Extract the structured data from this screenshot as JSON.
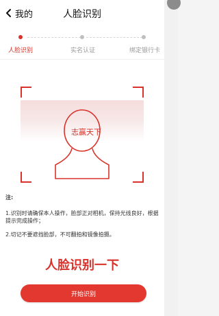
{
  "header": {
    "back_label": "我的",
    "title": "人脸识别"
  },
  "steps": [
    {
      "label": "人脸识别",
      "active": true
    },
    {
      "label": "实名认证",
      "active": false
    },
    {
      "label": "绑定银行卡",
      "active": false
    }
  ],
  "scan": {
    "watermark": "志赢天下"
  },
  "notes": {
    "title": "注:",
    "items": [
      "1.识别时请确保本人操作，脸部正对相机，保持光线良好，根据提示完成操作；",
      "2.切记不要遮挡脸部，不可翻拍和镜像拍摄。"
    ]
  },
  "slogan": "人脸识别一下",
  "button": {
    "label": "开始识别"
  },
  "colors": {
    "accent": "#d9322a",
    "inactive": "#bfbfbf"
  }
}
